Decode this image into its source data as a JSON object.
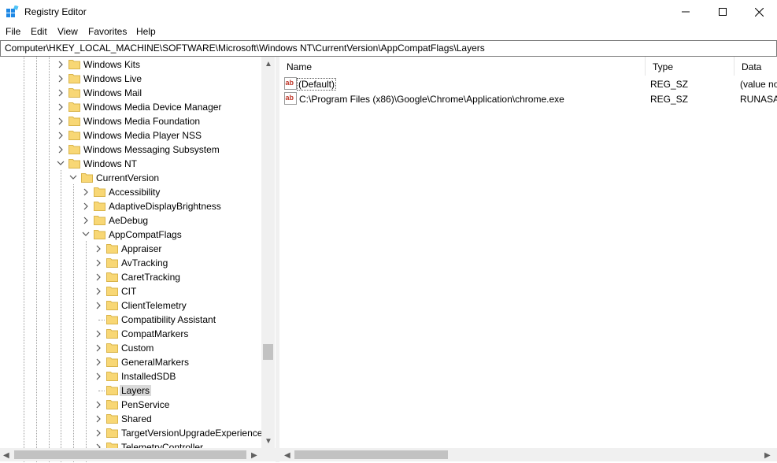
{
  "window": {
    "title": "Registry Editor",
    "controls": {
      "minimize": "─",
      "maximize": "☐",
      "close": "✕"
    }
  },
  "menu": [
    "File",
    "Edit",
    "View",
    "Favorites",
    "Help"
  ],
  "address": "Computer\\HKEY_LOCAL_MACHINE\\SOFTWARE\\Microsoft\\Windows NT\\CurrentVersion\\AppCompatFlags\\Layers",
  "tree": [
    {
      "label": "Windows Kits",
      "level": 0,
      "state": "collapsed"
    },
    {
      "label": "Windows Live",
      "level": 0,
      "state": "collapsed"
    },
    {
      "label": "Windows Mail",
      "level": 0,
      "state": "collapsed"
    },
    {
      "label": "Windows Media Device Manager",
      "level": 0,
      "state": "collapsed"
    },
    {
      "label": "Windows Media Foundation",
      "level": 0,
      "state": "collapsed"
    },
    {
      "label": "Windows Media Player NSS",
      "level": 0,
      "state": "collapsed"
    },
    {
      "label": "Windows Messaging Subsystem",
      "level": 0,
      "state": "collapsed"
    },
    {
      "label": "Windows NT",
      "level": 0,
      "state": "expanded"
    },
    {
      "label": "CurrentVersion",
      "level": 1,
      "state": "expanded"
    },
    {
      "label": "Accessibility",
      "level": 2,
      "state": "collapsed"
    },
    {
      "label": "AdaptiveDisplayBrightness",
      "level": 2,
      "state": "collapsed"
    },
    {
      "label": "AeDebug",
      "level": 2,
      "state": "collapsed"
    },
    {
      "label": "AppCompatFlags",
      "level": 2,
      "state": "expanded"
    },
    {
      "label": "Appraiser",
      "level": 3,
      "state": "collapsed"
    },
    {
      "label": "AvTracking",
      "level": 3,
      "state": "collapsed"
    },
    {
      "label": "CaretTracking",
      "level": 3,
      "state": "collapsed"
    },
    {
      "label": "CIT",
      "level": 3,
      "state": "collapsed"
    },
    {
      "label": "ClientTelemetry",
      "level": 3,
      "state": "collapsed"
    },
    {
      "label": "Compatibility Assistant",
      "level": 3,
      "state": "leaf"
    },
    {
      "label": "CompatMarkers",
      "level": 3,
      "state": "collapsed"
    },
    {
      "label": "Custom",
      "level": 3,
      "state": "collapsed"
    },
    {
      "label": "GeneralMarkers",
      "level": 3,
      "state": "collapsed"
    },
    {
      "label": "InstalledSDB",
      "level": 3,
      "state": "collapsed"
    },
    {
      "label": "Layers",
      "level": 3,
      "state": "leaf",
      "selected": true
    },
    {
      "label": "PenService",
      "level": 3,
      "state": "collapsed"
    },
    {
      "label": "Shared",
      "level": 3,
      "state": "collapsed"
    },
    {
      "label": "TargetVersionUpgradeExperienceIr",
      "level": 3,
      "state": "collapsed"
    },
    {
      "label": "TelemetryController",
      "level": 3,
      "state": "collapsed"
    }
  ],
  "columns": {
    "name": "Name",
    "type": "Type",
    "data": "Data"
  },
  "values": [
    {
      "name": "(Default)",
      "type": "REG_SZ",
      "data": "(value no",
      "icon": "ab"
    },
    {
      "name": "C:\\Program Files (x86)\\Google\\Chrome\\Application\\chrome.exe",
      "type": "REG_SZ",
      "data": "RUNASA",
      "icon": "ab"
    }
  ],
  "scroll": {
    "up": "▲",
    "down": "▼",
    "left": "◀",
    "right": "▶"
  }
}
